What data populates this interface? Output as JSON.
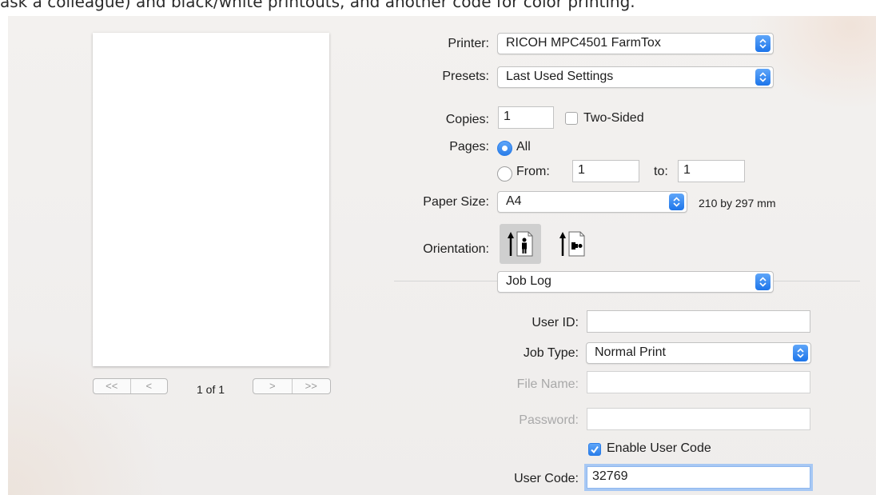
{
  "caption": "ask a colleague) and black/white printouts, and another code for color printing.",
  "preview": {
    "page_indicator": "1 of 1",
    "first_label": "<<",
    "prev_label": "<",
    "next_label": ">",
    "last_label": ">>"
  },
  "printer": {
    "label": "Printer:",
    "value": "RICOH MPC4501 FarmTox"
  },
  "presets": {
    "label": "Presets:",
    "value": "Last Used Settings"
  },
  "copies": {
    "label": "Copies:",
    "value": "1",
    "two_sided_label": "Two-Sided",
    "two_sided_checked": false
  },
  "pages": {
    "label": "Pages:",
    "all_label": "All",
    "from_label": "From:",
    "from_value": "1",
    "to_label": "to:",
    "to_value": "1",
    "selected": "All"
  },
  "paper_size": {
    "label": "Paper Size:",
    "value": "A4",
    "dimensions": "210 by 297 mm"
  },
  "orientation": {
    "label": "Orientation:",
    "selected": "portrait"
  },
  "section": {
    "value": "Job Log"
  },
  "job_log": {
    "user_id_label": "User ID:",
    "user_id_value": "",
    "job_type_label": "Job Type:",
    "job_type_value": "Normal Print",
    "file_name_label": "File Name:",
    "file_name_value": "",
    "password_label": "Password:",
    "password_value": "",
    "enable_user_code_label": "Enable User Code",
    "enable_user_code_checked": true,
    "user_code_label": "User Code:",
    "user_code_value": "32769"
  },
  "colors": {
    "accent": "#2b7ee9",
    "background": "#efedec"
  }
}
